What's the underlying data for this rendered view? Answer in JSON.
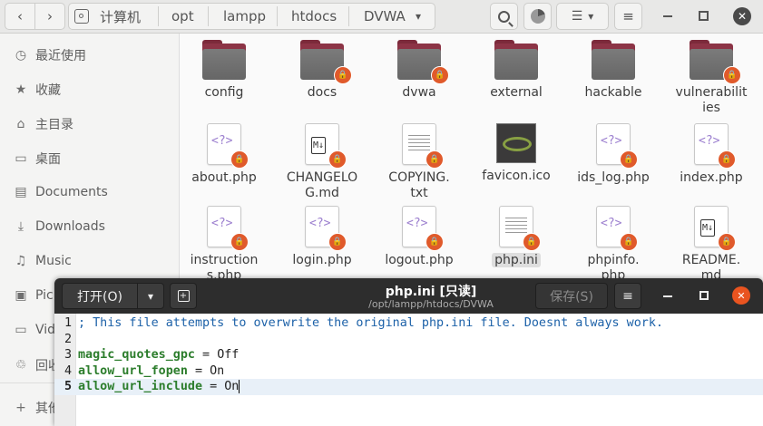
{
  "header": {
    "back_icon": "‹",
    "forward_icon": "›",
    "breadcrumbs": [
      "计算机",
      "opt",
      "lampp",
      "htdocs",
      "DVWA"
    ],
    "menu_arrow": "▾"
  },
  "sidebar": {
    "items": [
      {
        "label": "最近使用",
        "icon": "clock-icon",
        "glyph": "◷"
      },
      {
        "label": "收藏",
        "icon": "star-icon",
        "glyph": "★"
      },
      {
        "label": "主目录",
        "icon": "home-icon",
        "glyph": "⌂"
      },
      {
        "label": "桌面",
        "icon": "desktop-icon",
        "glyph": "▭"
      },
      {
        "label": "Documents",
        "icon": "document-icon",
        "glyph": "▤"
      },
      {
        "label": "Downloads",
        "icon": "download-icon",
        "glyph": "⤓"
      },
      {
        "label": "Music",
        "icon": "music-icon",
        "glyph": "♫"
      },
      {
        "label": "Pic",
        "icon": "picture-icon",
        "glyph": "▣"
      },
      {
        "label": "Vid",
        "icon": "video-icon",
        "glyph": "▭"
      },
      {
        "label": "回收",
        "icon": "trash-icon",
        "glyph": "♲"
      },
      {
        "label": "其他",
        "icon": "plus-icon",
        "glyph": "+"
      }
    ]
  },
  "files": {
    "row1": [
      {
        "name": "config",
        "kind": "folder",
        "locked": false
      },
      {
        "name": "docs",
        "kind": "folder",
        "locked": true
      },
      {
        "name": "dvwa",
        "kind": "folder",
        "locked": true
      },
      {
        "name": "external",
        "kind": "folder",
        "locked": false
      },
      {
        "name": "hackable",
        "kind": "folder",
        "locked": false
      },
      {
        "name": "vulnerabilit\nies",
        "kind": "folder",
        "locked": true
      }
    ],
    "row2": [
      {
        "name": "about.php",
        "kind": "php",
        "locked": true
      },
      {
        "name": "CHANGELO\nG.md",
        "kind": "md",
        "locked": true
      },
      {
        "name": "COPYING.\ntxt",
        "kind": "txt",
        "locked": true
      },
      {
        "name": "favicon.ico",
        "kind": "image",
        "locked": false
      },
      {
        "name": "ids_log.php",
        "kind": "php",
        "locked": true
      },
      {
        "name": "index.php",
        "kind": "php",
        "locked": true
      }
    ],
    "row3": [
      {
        "name": "instruction\ns.php",
        "kind": "php",
        "locked": true
      },
      {
        "name": "login.php",
        "kind": "php",
        "locked": true
      },
      {
        "name": "logout.php",
        "kind": "php",
        "locked": true
      },
      {
        "name": "php.ini",
        "kind": "txt",
        "locked": true,
        "selected": true
      },
      {
        "name": "phpinfo.\nphp",
        "kind": "php",
        "locked": true
      },
      {
        "name": "README.\nmd",
        "kind": "md",
        "locked": true
      }
    ]
  },
  "editor": {
    "open_label": "打开(O)",
    "title": "php.ini [只读]",
    "subtitle": "/opt/lampp/htdocs/DVWA",
    "save_label": "保存(S)",
    "lines": [
      {
        "num": "1",
        "comment": "; This file attempts to overwrite the original php.ini file. Doesnt always work."
      },
      {
        "num": "2",
        "comment": ""
      },
      {
        "num": "3",
        "key": "magic_quotes_gpc",
        "op": " = ",
        "value": "Off"
      },
      {
        "num": "4",
        "key": "allow_url_fopen",
        "op": " = ",
        "value": "On"
      },
      {
        "num": "5",
        "key": "allow_url_include",
        "op": " = ",
        "value": "On"
      }
    ]
  },
  "colors": {
    "lock_badge": "#e05a2b",
    "folder_tab": "#8c3446",
    "editor_header": "#2d2d2d",
    "close_button": "#e95420"
  }
}
